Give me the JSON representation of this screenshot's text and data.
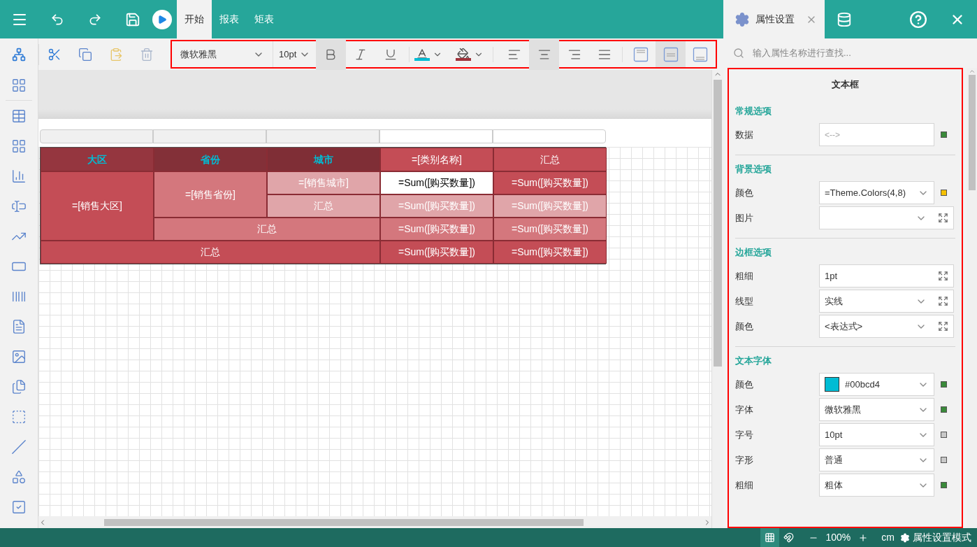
{
  "topbar": {
    "tabs": [
      {
        "label": "开始",
        "selected": true
      },
      {
        "label": "报表",
        "selected": false
      },
      {
        "label": "矩表",
        "selected": false
      }
    ]
  },
  "panel_tab": {
    "label": "属性设置",
    "selected": true
  },
  "toolbar": {
    "font": "微软雅黑",
    "size": "10pt",
    "bold": true,
    "italic": false,
    "underline": false,
    "h_align": [
      {
        "kind": "left",
        "selected": false
      },
      {
        "kind": "center",
        "selected": true
      },
      {
        "kind": "right",
        "selected": false
      },
      {
        "kind": "justify",
        "selected": false
      }
    ],
    "v_align": [
      {
        "kind": "top",
        "selected": false
      },
      {
        "kind": "middle",
        "selected": true
      },
      {
        "kind": "bottom",
        "selected": false
      }
    ]
  },
  "matrix": {
    "cells": [
      {
        "text": "大区",
        "kind": "header",
        "color": "#95363f",
        "selected": false
      },
      {
        "text": "省份",
        "kind": "header",
        "color": "#833038",
        "selected": false
      },
      {
        "text": "城市",
        "kind": "header",
        "color": "#7f2e36",
        "selected": false
      },
      {
        "text": "=[类别名称]",
        "kind": "data",
        "color": "#c44d56",
        "selected": false
      },
      {
        "text": "汇总",
        "kind": "data",
        "color": "#c44d56",
        "selected": false
      },
      {
        "text": "=[销售大区]",
        "kind": "data",
        "color": "#c44d56",
        "selected": false
      },
      {
        "text": "=[销售省份]",
        "kind": "data",
        "color": "#d4777d",
        "selected": false
      },
      {
        "text": "=[销售城市]",
        "kind": "data",
        "color": "#e0a5a9",
        "selected": false
      },
      {
        "text": "=Sum([购买数量])",
        "kind": "data",
        "selected": true
      },
      {
        "text": "=Sum([购买数量])",
        "kind": "data",
        "color": "#c44d56",
        "selected": false
      },
      {
        "text": "汇总",
        "kind": "data",
        "color": "#e0a5a9",
        "selected": false
      },
      {
        "text": "=Sum([购买数量])",
        "kind": "data",
        "color": "#e0a5a9",
        "selected": false
      },
      {
        "text": "=Sum([购买数量])",
        "kind": "data",
        "color": "#e0a5a9",
        "selected": false
      },
      {
        "text": "汇总",
        "kind": "data",
        "color": "#d4777d",
        "selected": false
      },
      {
        "text": "=Sum([购买数量])",
        "kind": "data",
        "color": "#d4777d",
        "selected": false
      },
      {
        "text": "=Sum([购买数量])",
        "kind": "data",
        "color": "#d4777d",
        "selected": false
      },
      {
        "text": "汇总",
        "kind": "data",
        "color": "#c44d56",
        "selected": false
      },
      {
        "text": "=Sum([购买数量])",
        "kind": "data",
        "color": "#c44d56",
        "selected": false
      },
      {
        "text": "=Sum([购买数量])",
        "kind": "data",
        "color": "#c44d56",
        "selected": false
      }
    ]
  },
  "properties": {
    "search": {
      "placeholder": "输入属性名称进行查找..."
    },
    "title": "文本框",
    "sections": [
      {
        "heading": "常规选项",
        "rows": [
          {
            "label": "数据",
            "kind": "text",
            "placeholder": "<-->",
            "color": "#3a8a3a",
            "expandable": false
          }
        ]
      },
      {
        "heading": "背景选项",
        "rows": [
          {
            "label": "颜色",
            "kind": "dropdown",
            "value": "=Theme.Colors(4,8)",
            "color": "#f5c000",
            "expandable": false
          },
          {
            "label": "图片",
            "kind": "dropdown",
            "expandable": true
          }
        ]
      },
      {
        "heading": "边框选项",
        "rows": [
          {
            "label": "粗细",
            "kind": "text",
            "value": "1pt",
            "expandable": true
          },
          {
            "label": "线型",
            "kind": "dropdown",
            "value": "实线",
            "expandable": true
          },
          {
            "label": "颜色",
            "kind": "dropdown",
            "value": "<表达式>",
            "expandable": true
          }
        ]
      },
      {
        "heading": "文本字体",
        "rows": [
          {
            "label": "颜色",
            "kind": "colorpicker",
            "value": "#00bcd4",
            "color": "#3a8a3a",
            "expandable": false
          },
          {
            "label": "字体",
            "kind": "dropdown",
            "value": "微软雅黑",
            "color": "#3a8a3a",
            "expandable": false
          },
          {
            "label": "字号",
            "kind": "dropdown",
            "value": "10pt",
            "color": "#c8c8c8",
            "expandable": false
          },
          {
            "label": "字形",
            "kind": "dropdown",
            "value": "普通",
            "color": "#c8c8c8",
            "expandable": false
          },
          {
            "label": "粗细",
            "kind": "dropdown",
            "value": "粗体",
            "color": "#3a8a3a",
            "expandable": false
          }
        ]
      }
    ]
  },
  "status_bar": {
    "grid_on": true,
    "zoom": "100%",
    "unit": "cm",
    "mode": "属性设置模式"
  }
}
